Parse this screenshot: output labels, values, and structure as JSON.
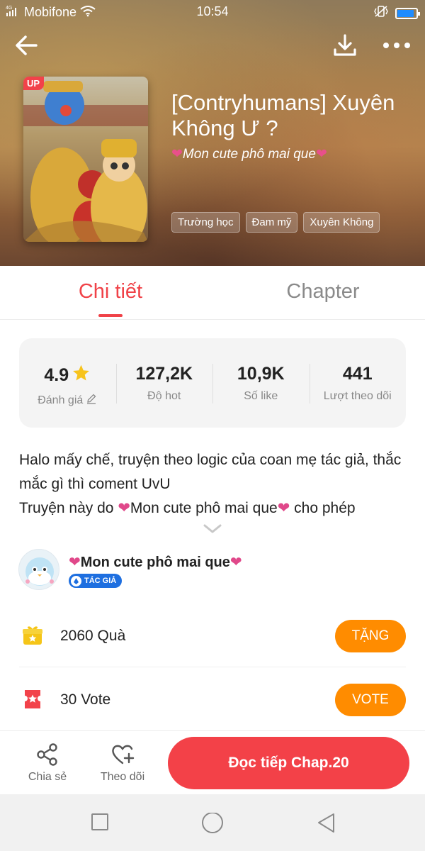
{
  "status_bar": {
    "network": "4G",
    "carrier": "Mobifone",
    "time": "10:54",
    "battery_percent": 85
  },
  "header": {
    "back_icon": "arrow-left-icon",
    "download_icon": "download-icon",
    "more_icon": "more-dots-icon",
    "cover_badge": "UP",
    "title": "[Contryhumans] Xuyên Không Ư ?",
    "author_display": "Mon cute phô mai que",
    "heart_glyph": "❤",
    "tags": [
      "Trường học",
      "Đam mỹ",
      "Xuyên Không"
    ]
  },
  "tabs": [
    {
      "label": "Chi tiết",
      "active": true
    },
    {
      "label": "Chapter",
      "active": false
    }
  ],
  "stats": [
    {
      "value": "4.9",
      "label": "Đánh giá",
      "icon": "star-icon",
      "label_icon": "edit-icon"
    },
    {
      "value": "127,2K",
      "label": "Độ hot"
    },
    {
      "value": "10,9K",
      "label": "Số like"
    },
    {
      "value": "441",
      "label": "Lượt theo dõi"
    }
  ],
  "description": {
    "line1": "Halo mấy chế, truyện theo logic của coan mẹ tác giả, thắc mắc gì thì coment UvU",
    "line2_prefix": "Truyện này do ",
    "line2_name": "Mon cute phô mai que",
    "line2_suffix": " cho phép",
    "expand_icon": "chevron-down-icon"
  },
  "author": {
    "name": "Mon cute phô mai que",
    "badge": "TÁC GIẢ"
  },
  "gift": {
    "text": "2060  Quà",
    "button": "TẶNG",
    "icon": "gift-icon"
  },
  "vote": {
    "text": "30  Vote",
    "button": "VOTE",
    "icon": "ticket-icon"
  },
  "actions": {
    "share_label": "Chia sẻ",
    "follow_label": "Theo dõi",
    "read_button": "Đọc tiếp Chap.20"
  },
  "colors": {
    "accent": "#f04248",
    "orange": "#ff8c00",
    "badge_blue": "#1e6fe0"
  }
}
